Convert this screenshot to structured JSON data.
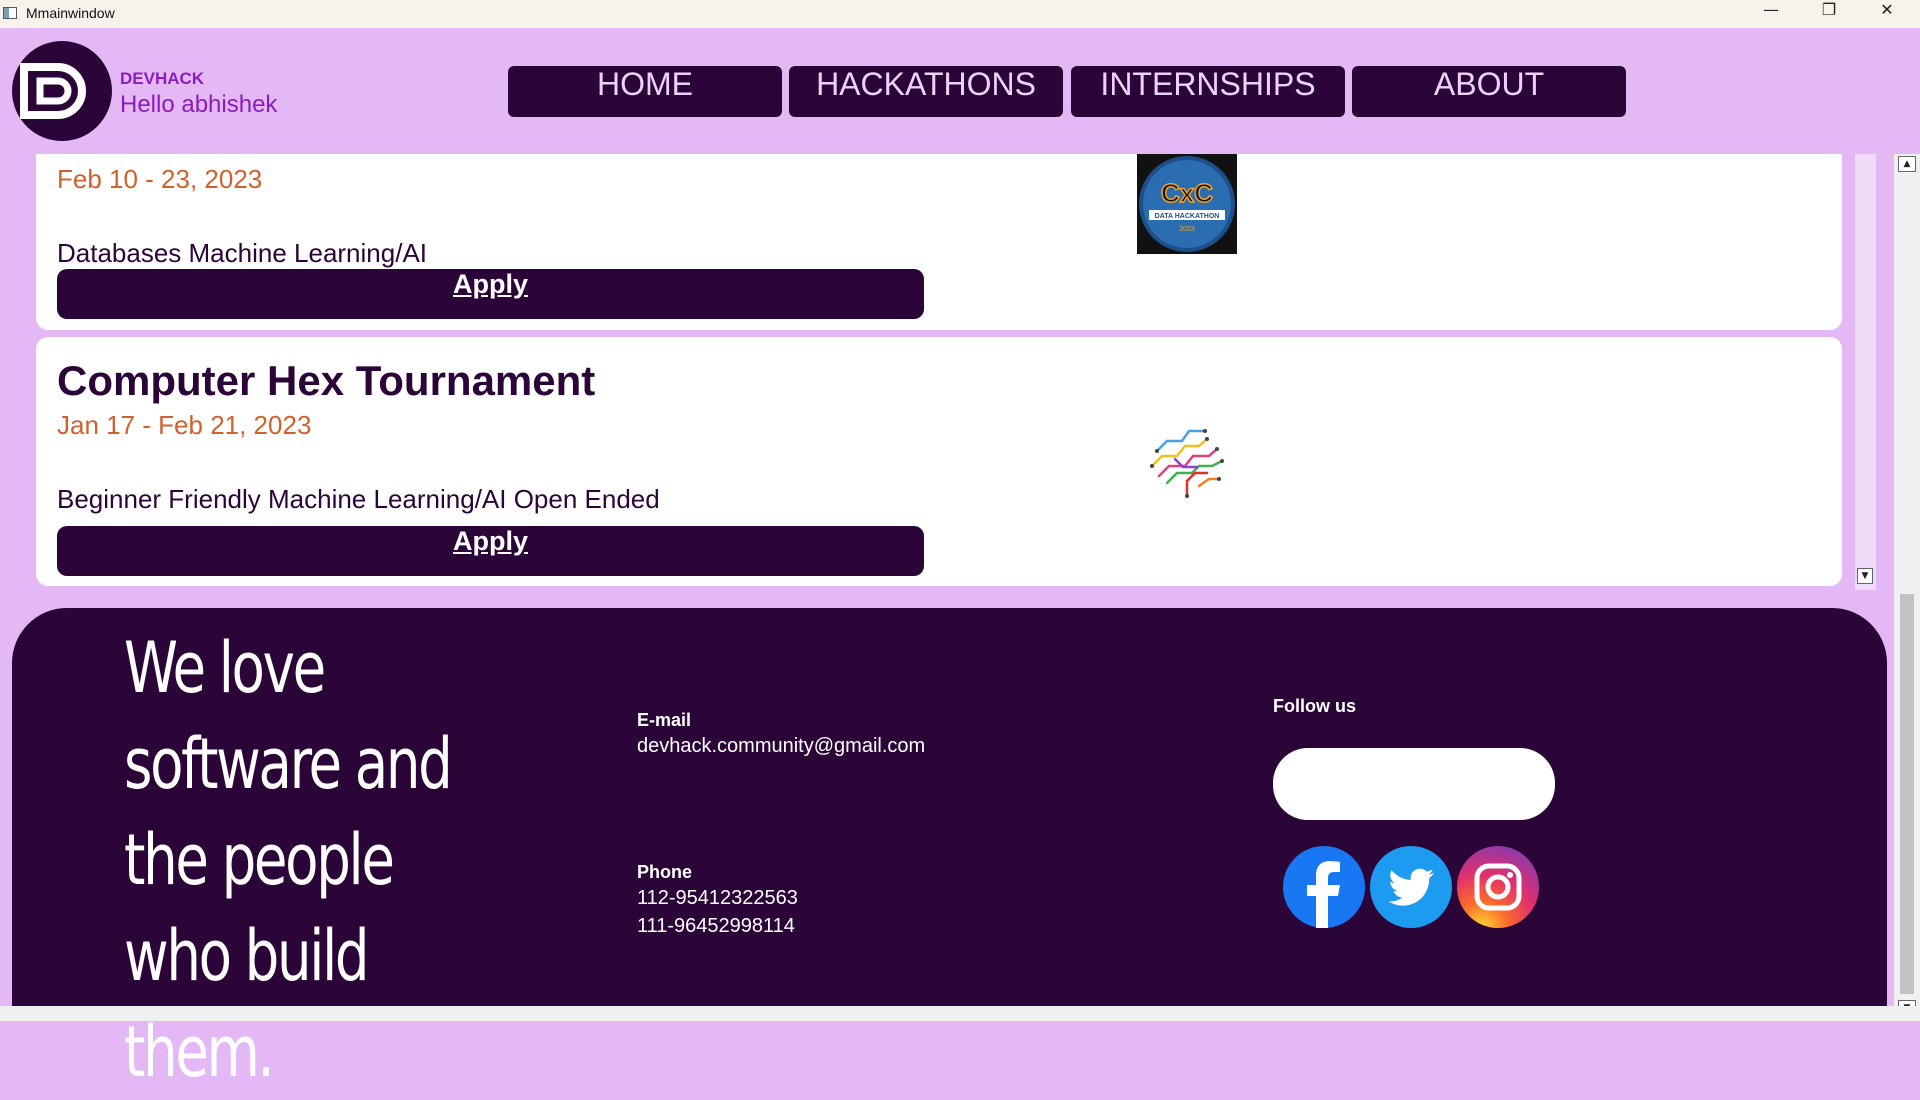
{
  "window": {
    "title": "Mmainwindow",
    "minimize": "—",
    "maximize": "❐",
    "close": "✕"
  },
  "header": {
    "brand": "DEVHACK",
    "greeting": "Hello abhishek",
    "nav": [
      "HOME",
      "HACKATHONS",
      "INTERNSHIPS",
      "ABOUT"
    ]
  },
  "hackathons": [
    {
      "title": "",
      "date": "Feb 10 - 23, 2023",
      "tags": "Databases Machine Learning/AI",
      "apply_label": "Apply",
      "image_icon": "data-hackathon-logo"
    },
    {
      "title": "Computer Hex Tournament",
      "date": "Jan 17 - Feb 21, 2023",
      "tags": "Beginner Friendly Machine Learning/AI Open Ended",
      "apply_label": "Apply",
      "image_icon": "circuit-brain-logo"
    }
  ],
  "footer": {
    "tagline": "We love software and the people who build them.",
    "email_label": "E-mail",
    "email": "devhack.community@gmail.com",
    "phone_label": "Phone",
    "phones": [
      "112-95412322563",
      "111-96452998114"
    ],
    "follow_label": "Follow us",
    "follow_input_value": "",
    "socials": [
      "facebook-icon",
      "twitter-icon",
      "instagram-icon"
    ]
  },
  "logo_text": "CxC",
  "logo_subtext": "DATA HACKATHON",
  "logo_year": "2023",
  "colors": {
    "primary": "#2c0538",
    "background": "#e4b8f4",
    "accent": "#8b1cc0",
    "date": "#d2602c"
  }
}
